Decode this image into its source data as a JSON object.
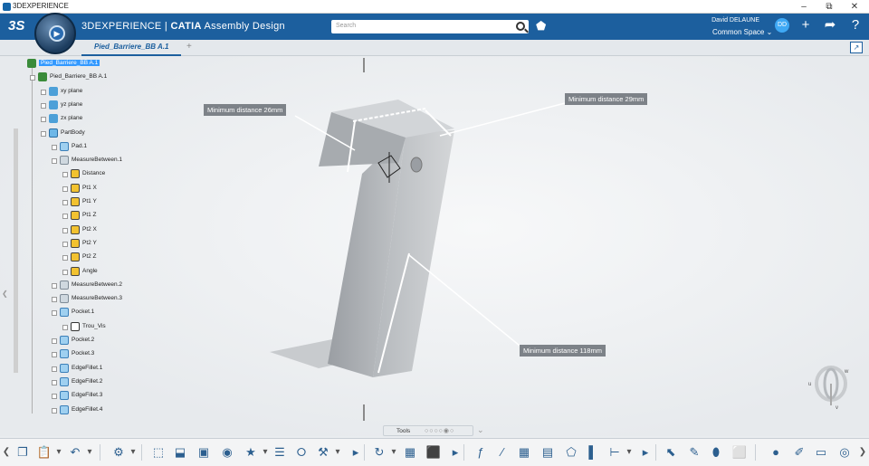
{
  "window": {
    "title": "3DEXPERIENCE",
    "minimize": "–",
    "maximize": "⧉",
    "close": "✕"
  },
  "app": {
    "logo": "3S",
    "brand_prefix": "3DEXPERIENCE | ",
    "brand_bold": "CATIA",
    "brand_app": " Assembly Design",
    "search_placeholder": "Search",
    "user_name": "David DELAUNE",
    "space": "Common Space ⌄",
    "avatar": "DD",
    "icons": [
      "tag-icon",
      "add-icon",
      "share-icon",
      "help-icon"
    ]
  },
  "tabs": {
    "active": "Pied_Barriere_BB A.1",
    "add": "+"
  },
  "tree": [
    {
      "label": "Pied_Barriere_BB A.1",
      "icon": "root-product-icon",
      "level": 0,
      "selected": true
    },
    {
      "label": "Pied_Barriere_BB A.1",
      "icon": "part-icon",
      "level": 1
    },
    {
      "label": "xy plane",
      "icon": "plane-icon",
      "level": 2
    },
    {
      "label": "yz plane",
      "icon": "plane-icon",
      "level": 2
    },
    {
      "label": "zx plane",
      "icon": "plane-icon",
      "level": 2
    },
    {
      "label": "PartBody",
      "icon": "body-icon",
      "level": 2
    },
    {
      "label": "Pad.1",
      "icon": "pad-icon",
      "level": 3
    },
    {
      "label": "MeasureBetween.1",
      "icon": "measure-icon",
      "level": 3
    },
    {
      "label": "Distance",
      "icon": "parameter-icon",
      "level": 4
    },
    {
      "label": "Pt1 X",
      "icon": "parameter-icon",
      "level": 4
    },
    {
      "label": "Pt1 Y",
      "icon": "parameter-icon",
      "level": 4
    },
    {
      "label": "Pt1 Z",
      "icon": "parameter-icon",
      "level": 4
    },
    {
      "label": "Pt2 X",
      "icon": "parameter-icon",
      "level": 4
    },
    {
      "label": "Pt2 Y",
      "icon": "parameter-icon",
      "level": 4
    },
    {
      "label": "Pt2 Z",
      "icon": "parameter-icon",
      "level": 4
    },
    {
      "label": "Angle",
      "icon": "parameter-icon",
      "level": 4
    },
    {
      "label": "MeasureBetween.2",
      "icon": "measure-icon",
      "level": 3
    },
    {
      "label": "MeasureBetween.3",
      "icon": "measure-icon",
      "level": 3
    },
    {
      "label": "Pocket.1",
      "icon": "pocket-icon",
      "level": 3
    },
    {
      "label": "Trou_Vis",
      "icon": "sketch-icon",
      "level": 4
    },
    {
      "label": "Pocket.2",
      "icon": "pocket-icon",
      "level": 3
    },
    {
      "label": "Pocket.3",
      "icon": "pocket-icon",
      "level": 3
    },
    {
      "label": "EdgeFillet.1",
      "icon": "fillet-icon",
      "level": 3
    },
    {
      "label": "EdgeFillet.2",
      "icon": "fillet-icon",
      "level": 3
    },
    {
      "label": "EdgeFillet.3",
      "icon": "fillet-icon",
      "level": 3
    },
    {
      "label": "EdgeFillet.4",
      "icon": "fillet-icon",
      "level": 3
    }
  ],
  "dimensions": {
    "d1": "Minimum distance 26mm",
    "d2": "Minimum distance 29mm",
    "d3": "Minimum distance 118mm"
  },
  "compass": {
    "u": "u",
    "v": "v",
    "w": "w"
  },
  "tools": {
    "label": "Tools",
    "dots": "○○○○◉○"
  },
  "colors": {
    "appbar": "#1c5f9e",
    "selection": "#3399ff",
    "dimension_label": "#7d8288"
  }
}
